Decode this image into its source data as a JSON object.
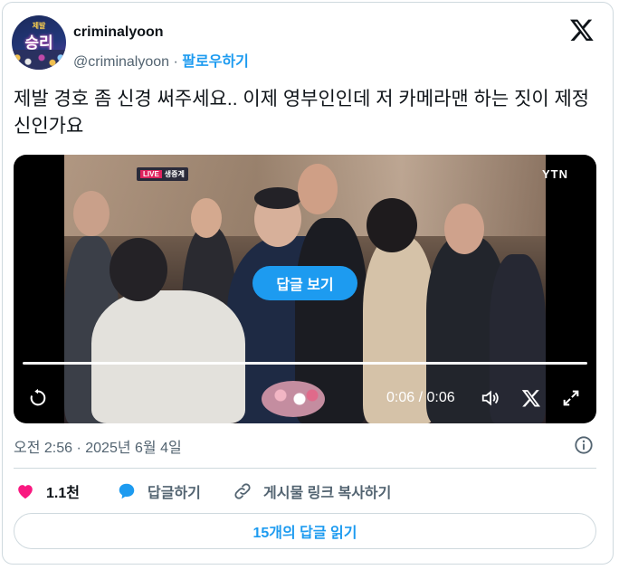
{
  "author": {
    "display_name": "criminalyoon",
    "handle": "@criminalyoon",
    "separator": "·",
    "follow_label": "팔로우하기",
    "avatar_text": "승리",
    "avatar_small_text": "제발"
  },
  "tweet": {
    "text": "제발 경호 좀 신경 써주세요.. 이제 영부인인데 저 카메라맨 하는 짓이 제정신인가요"
  },
  "media": {
    "live_label": "LIVE",
    "broadcast_label": "생중계",
    "channel_label": "YTN",
    "reply_pill_label": "답글 보기",
    "time_display": "0:06 / 0:06",
    "progress": 1.0
  },
  "meta": {
    "timestamp": "오전 2:56 · 2025년 6월 4일"
  },
  "actions": {
    "like_count": "1.1천",
    "reply_label": "답글하기",
    "copy_link_label": "게시물 링크 복사하기"
  },
  "footer": {
    "read_replies_label": "15개의 답글 읽기"
  },
  "colors": {
    "accent": "#1d9bf0",
    "like": "#f91880",
    "text_primary": "#0f1419",
    "text_secondary": "#536471"
  }
}
